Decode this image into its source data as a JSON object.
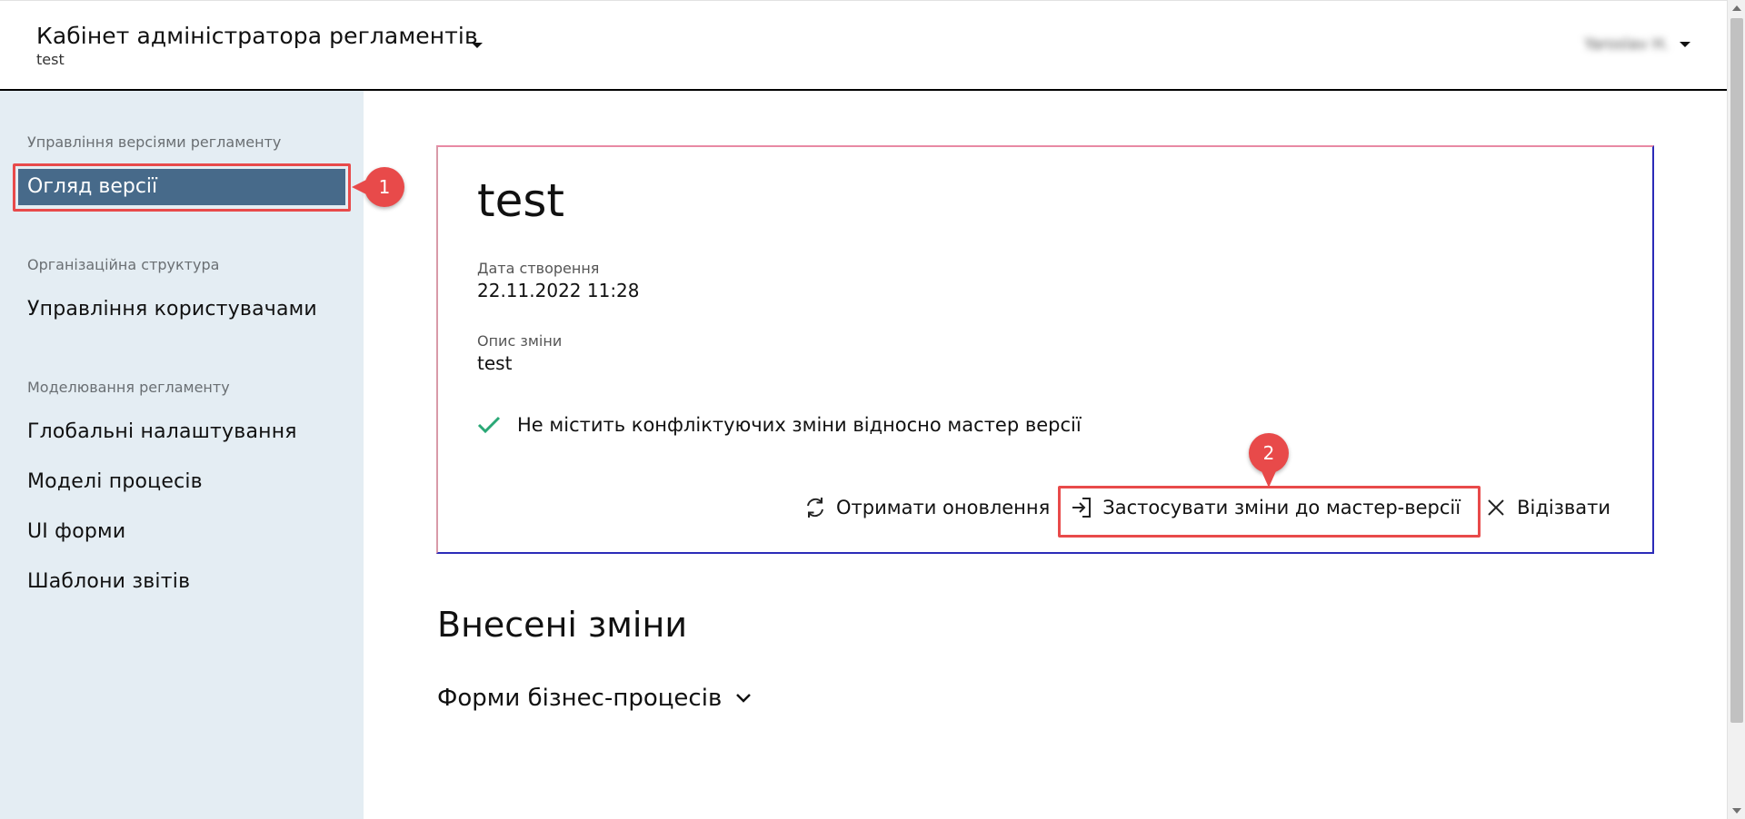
{
  "header": {
    "title": "Кабінет адміністратора регламентів",
    "subtitle": "test",
    "user_name": "Yaroslav H."
  },
  "sidebar": {
    "sections": [
      {
        "label": "Управління версіями регламенту",
        "items": [
          {
            "label": "Огляд версії",
            "active": true
          }
        ]
      },
      {
        "label": "Організаційна структура",
        "items": [
          {
            "label": "Управління користувачами",
            "active": false
          }
        ]
      },
      {
        "label": "Моделювання регламенту",
        "items": [
          {
            "label": "Глобальні налаштування",
            "active": false
          },
          {
            "label": "Моделі процесів",
            "active": false
          },
          {
            "label": "UI форми",
            "active": false
          },
          {
            "label": "Шаблони звітів",
            "active": false
          }
        ]
      }
    ]
  },
  "card": {
    "title": "test",
    "created_label": "Дата створення",
    "created_value": "22.11.2022 11:28",
    "description_label": "Опис зміни",
    "description_value": "test",
    "status_text": "Не містить конфліктуючих зміни відносно мастер версії",
    "actions": {
      "refresh_label": "Отримати оновлення",
      "apply_label": "Застосувати зміни до мастер-версії",
      "revoke_label": "Відізвати"
    }
  },
  "changes": {
    "title": "Внесені зміни",
    "group_label": "Форми бізнес-процесів"
  },
  "callouts": {
    "first": "1",
    "second": "2"
  },
  "colors": {
    "sidebar_bg": "#e4edf3",
    "active_item_bg": "#476a8a",
    "highlight": "#e84a4a",
    "check": "#2aa876",
    "card_border": "#2b2bb8"
  }
}
